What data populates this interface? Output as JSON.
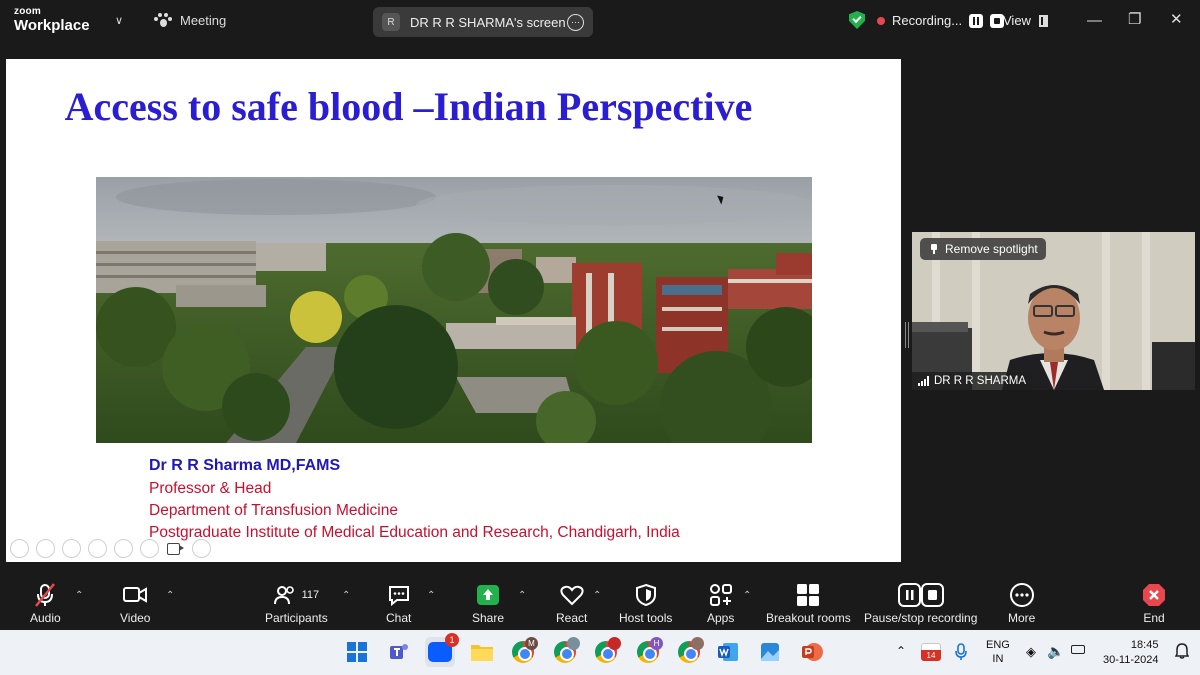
{
  "app": {
    "brand_top": "zoom",
    "brand_bottom": "Workplace",
    "meeting_label": "Meeting"
  },
  "screen_share": {
    "avatar": "R",
    "label": "DR R R SHARMA's screen"
  },
  "recording": {
    "label": "Recording...",
    "view_label": "View"
  },
  "slide": {
    "title": "Access to safe blood –Indian Perspective",
    "presenter_name": "Dr R R Sharma MD,FAMS",
    "presenter_lines": [
      "Professor & Head",
      "Department of Transfusion Medicine",
      "Postgraduate Institute of Medical Education and Research, Chandigarh, India"
    ]
  },
  "video_tile": {
    "spotlight_label": "Remove spotlight",
    "participant_name": "DR R R SHARMA"
  },
  "toolbar": {
    "audio": "Audio",
    "video": "Video",
    "participants": "Participants",
    "participants_count": "117",
    "chat": "Chat",
    "share": "Share",
    "react": "React",
    "host_tools": "Host tools",
    "apps": "Apps",
    "breakout_rooms": "Breakout rooms",
    "pause_stop_recording": "Pause/stop recording",
    "more": "More",
    "end": "End"
  },
  "taskbar": {
    "zoom_badge": "1",
    "chrome_profiles": [
      "M",
      "",
      "",
      "H",
      ""
    ],
    "calendar_date": "14",
    "language_top": "ENG",
    "language_bottom": "IN",
    "time": "18:45",
    "date": "30-11-2024"
  },
  "colors": {
    "title_blue": "#2b1dd2",
    "name_blue": "#1f17b8",
    "detail_red": "#c8102e",
    "share_green": "#23b14d",
    "end_red": "#e8484d"
  }
}
